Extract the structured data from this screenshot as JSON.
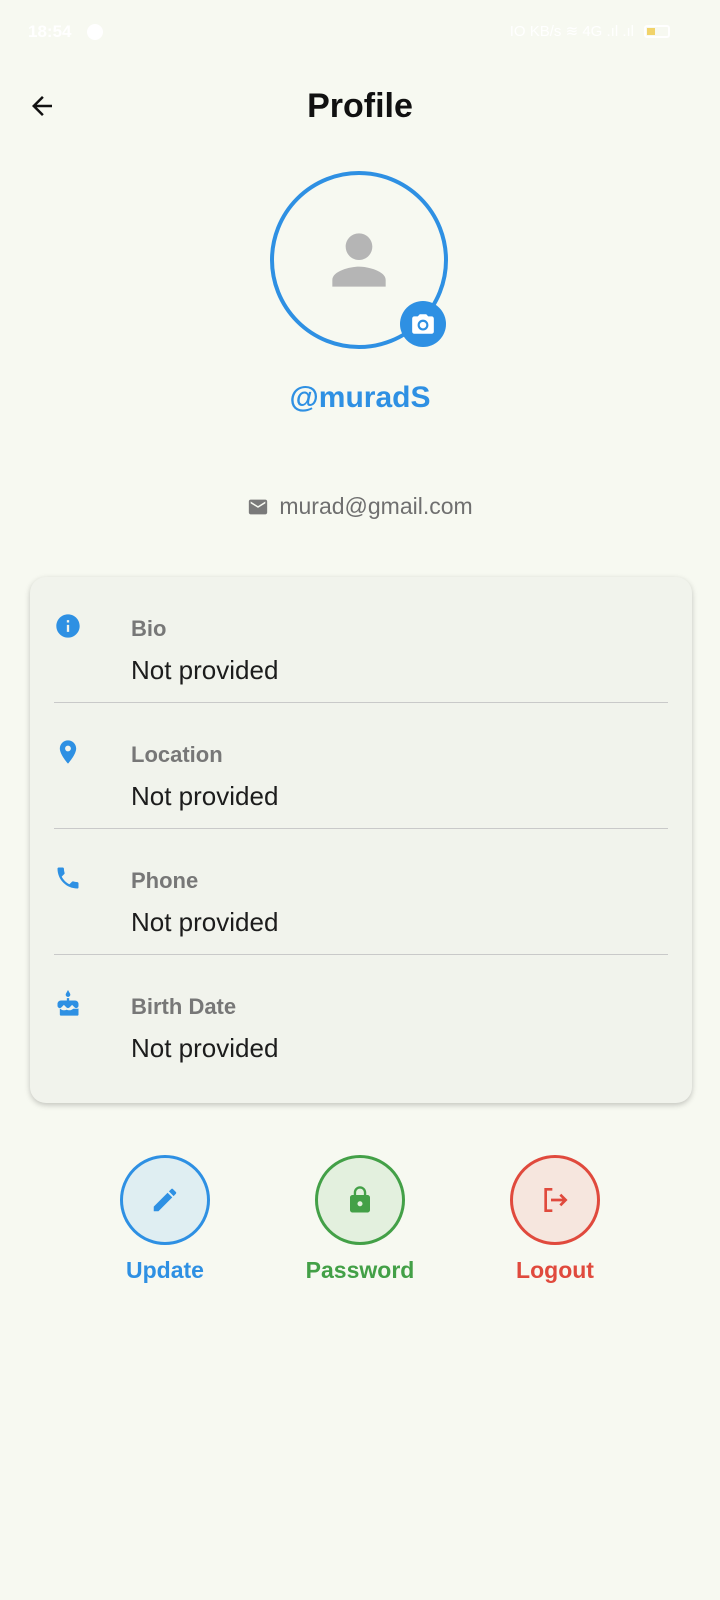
{
  "status_bar": {
    "time": "18:54",
    "indicators": "IO KB/s  ≋  4G .ıl .ıl"
  },
  "header": {
    "title": "Profile",
    "back_icon": "arrow-left-icon"
  },
  "profile": {
    "username": "@muradS",
    "email": "murad@gmail.com",
    "avatar_icon": "person-icon",
    "camera_icon": "camera-icon"
  },
  "details": [
    {
      "icon": "info-icon",
      "label": "Bio",
      "value": "Not provided"
    },
    {
      "icon": "location-pin-icon",
      "label": "Location",
      "value": "Not provided"
    },
    {
      "icon": "phone-icon",
      "label": "Phone",
      "value": "Not provided"
    },
    {
      "icon": "cake-icon",
      "label": "Birth Date",
      "value": "Not provided"
    }
  ],
  "actions": {
    "update": {
      "label": "Update",
      "icon": "pencil-icon",
      "color": "#2e90e3"
    },
    "password": {
      "label": "Password",
      "icon": "lock-icon",
      "color": "#43a047"
    },
    "logout": {
      "label": "Logout",
      "icon": "logout-icon",
      "color": "#e04a3d"
    }
  },
  "colors": {
    "accent": "#2e90e3",
    "background": "#f7f9f1",
    "card": "#f1f3ec"
  }
}
